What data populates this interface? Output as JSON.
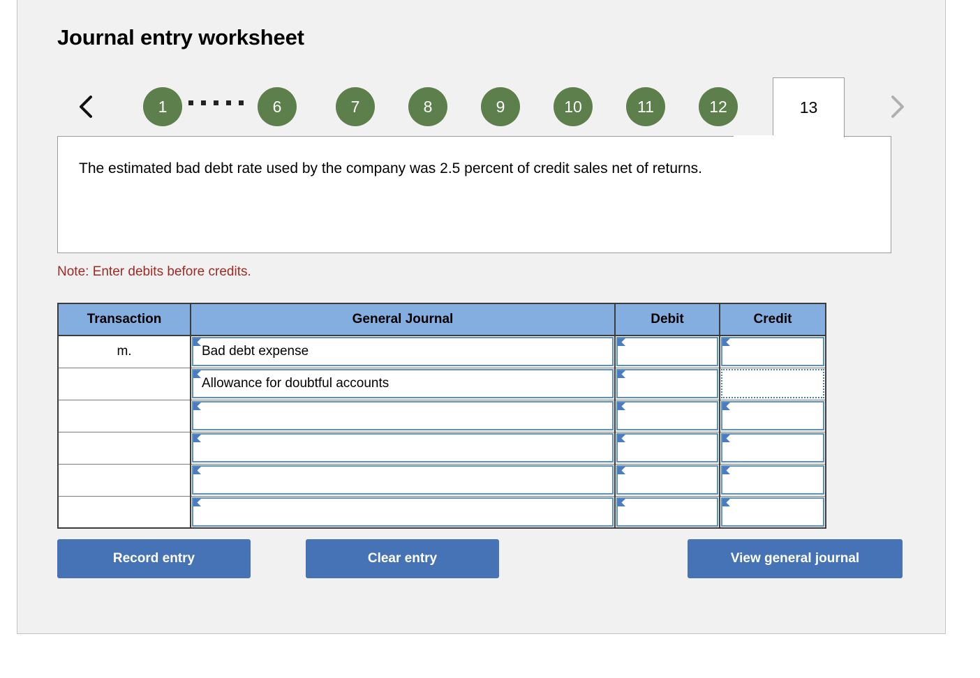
{
  "page": {
    "title": "Journal entry worksheet"
  },
  "tabs": {
    "prev_icon": "chevron-left-icon",
    "next_icon": "chevron-right-icon",
    "ellipsis_dots": 5,
    "items": [
      {
        "label": "1",
        "state": "complete"
      },
      {
        "label": "6",
        "state": "complete"
      },
      {
        "label": "7",
        "state": "complete"
      },
      {
        "label": "8",
        "state": "complete"
      },
      {
        "label": "9",
        "state": "complete"
      },
      {
        "label": "10",
        "state": "complete"
      },
      {
        "label": "11",
        "state": "complete"
      },
      {
        "label": "12",
        "state": "complete"
      }
    ],
    "active": {
      "label": "13",
      "state": "active"
    }
  },
  "panel": {
    "text": "The estimated bad debt rate used by the company was 2.5 percent of credit sales net of returns."
  },
  "note": {
    "text": "Note: Enter debits before credits."
  },
  "table": {
    "headers": {
      "transaction": "Transaction",
      "general_journal": "General Journal",
      "debit": "Debit",
      "credit": "Credit"
    },
    "rows": [
      {
        "transaction": "m.",
        "general_journal": "Bad debt expense",
        "debit": "",
        "credit": "",
        "credit_selected": false
      },
      {
        "transaction": "",
        "general_journal": "Allowance for doubtful accounts",
        "debit": "",
        "credit": "",
        "credit_selected": true
      },
      {
        "transaction": "",
        "general_journal": "",
        "debit": "",
        "credit": "",
        "credit_selected": false
      },
      {
        "transaction": "",
        "general_journal": "",
        "debit": "",
        "credit": "",
        "credit_selected": false
      },
      {
        "transaction": "",
        "general_journal": "",
        "debit": "",
        "credit": "",
        "credit_selected": false
      },
      {
        "transaction": "",
        "general_journal": "",
        "debit": "",
        "credit": "",
        "credit_selected": false
      }
    ]
  },
  "buttons": {
    "record": "Record entry",
    "clear": "Clear entry",
    "view": "View general journal"
  },
  "colors": {
    "tab_complete": "#5c7f4b",
    "table_header": "#85aee0",
    "button": "#4573b5",
    "note": "#9e2a24",
    "cell_border": "#5b8fcc",
    "card_bg": "#f1f1f1"
  }
}
